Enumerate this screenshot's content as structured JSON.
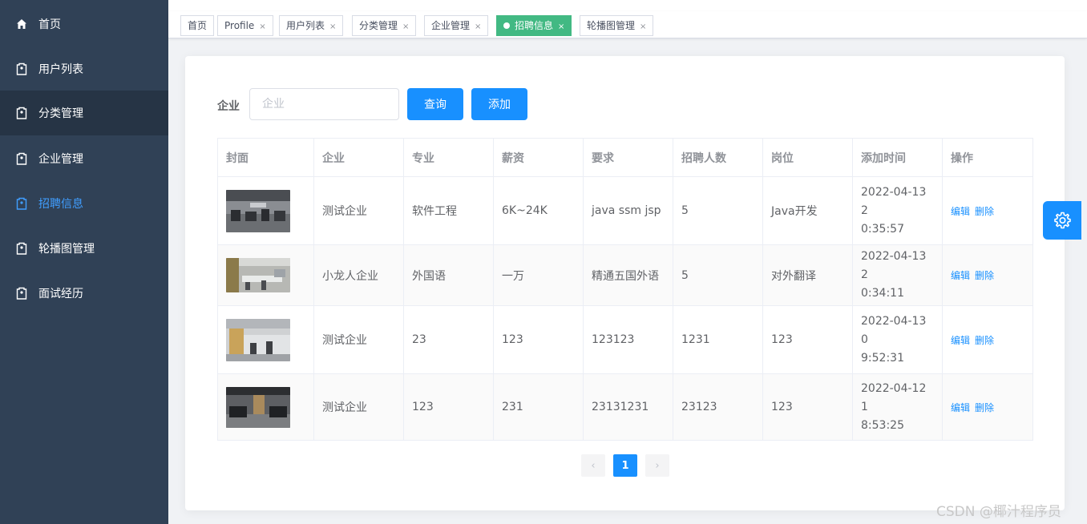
{
  "sidebar": {
    "items": [
      {
        "label": "首页",
        "icon": "home-icon"
      },
      {
        "label": "用户列表",
        "icon": "tag-icon"
      },
      {
        "label": "分类管理",
        "icon": "tag-icon"
      },
      {
        "label": "企业管理",
        "icon": "tag-icon"
      },
      {
        "label": "招聘信息",
        "icon": "tag-icon"
      },
      {
        "label": "轮播图管理",
        "icon": "tag-icon"
      },
      {
        "label": "面试经历",
        "icon": "tag-icon"
      }
    ],
    "active_index": 4
  },
  "tags": [
    {
      "label": "首页",
      "closable": false
    },
    {
      "label": "Profile",
      "closable": true
    },
    {
      "label": "用户列表",
      "closable": true
    },
    {
      "label": "分类管理",
      "closable": true
    },
    {
      "label": "企业管理",
      "closable": true
    },
    {
      "label": "招聘信息",
      "closable": true,
      "active": true
    },
    {
      "label": "轮播图管理",
      "closable": true
    }
  ],
  "search": {
    "label": "企业",
    "placeholder": "企业",
    "value": "",
    "query_button": "查询",
    "add_button": "添加"
  },
  "table": {
    "columns": [
      "封面",
      "企业",
      "专业",
      "薪资",
      "要求",
      "招聘人数",
      "岗位",
      "添加时间",
      "操作"
    ],
    "rows": [
      {
        "company": "测试企业",
        "major": "软件工程",
        "salary": "6K~24K",
        "requirement": "java ssm jsp",
        "headcount": "5",
        "position": "Java开发",
        "time_line1": "2022-04-13 2",
        "time_line2": "0:35:57"
      },
      {
        "company": "小龙人企业",
        "major": "外国语",
        "salary": "一万",
        "requirement": "精通五国外语",
        "headcount": "5",
        "position": "对外翻译",
        "time_line1": "2022-04-13 2",
        "time_line2": "0:34:11"
      },
      {
        "company": "测试企业",
        "major": "23",
        "salary": "123",
        "requirement": "123123",
        "headcount": "1231",
        "position": "123",
        "time_line1": "2022-04-13 0",
        "time_line2": "9:52:31"
      },
      {
        "company": "测试企业",
        "major": "123",
        "salary": "231",
        "requirement": "23131231",
        "headcount": "23123",
        "position": "123",
        "time_line1": "2022-04-12 1",
        "time_line2": "8:53:25"
      }
    ],
    "edit_label": "编辑",
    "delete_label": "删除"
  },
  "pagination": {
    "current_page": "1",
    "prev": "‹",
    "next": "›"
  },
  "watermark": "CSDN @椰汁程序员",
  "colors": {
    "sidebar_bg": "#304156",
    "primary": "#1890ff",
    "active_tag": "#42b983",
    "menu_active": "#409eff"
  }
}
